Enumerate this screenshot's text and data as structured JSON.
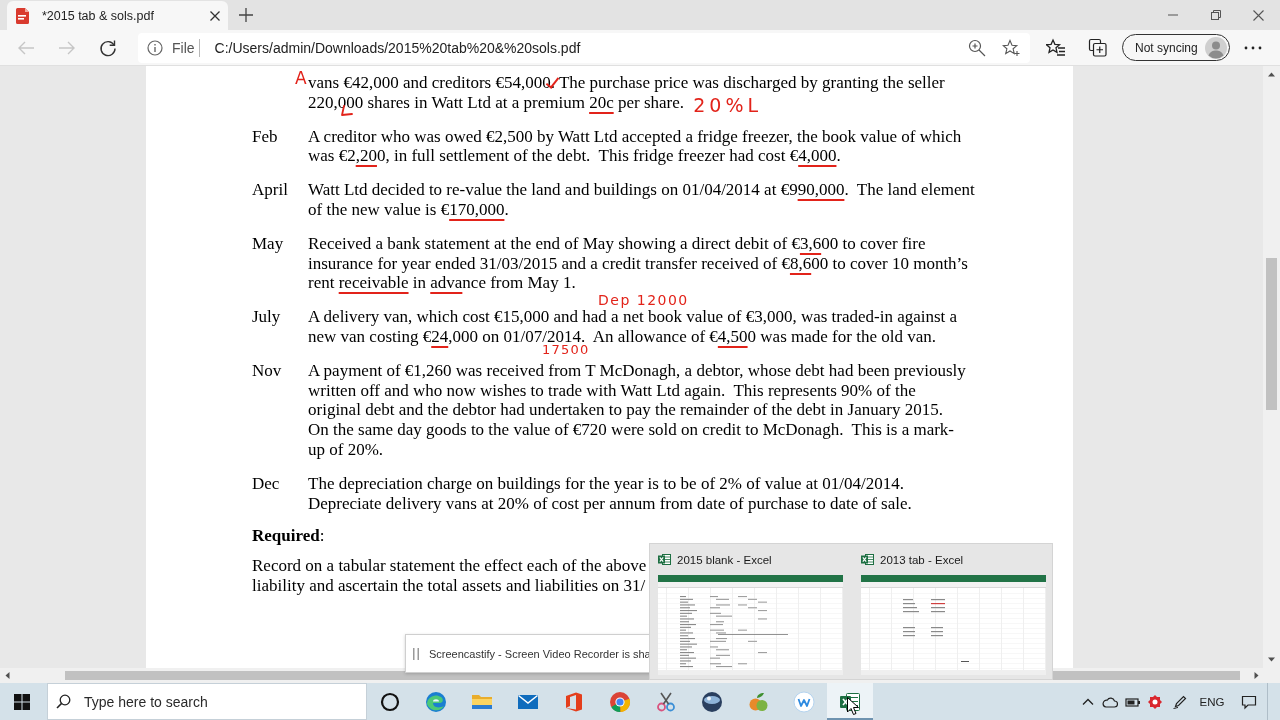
{
  "browser": {
    "tab": {
      "title": "*2015 tab & sols.pdf",
      "selected": true
    },
    "navigation": {
      "back": {
        "disabled": true
      },
      "forward": {
        "disabled": true
      }
    },
    "address_bar": {
      "scheme": "File",
      "url": "C:/Users/admin/Downloads/2015%20tab%20&%20sols.pdf"
    },
    "profile": {
      "label": "Not syncing"
    }
  },
  "document": {
    "entries": [
      {
        "runs": [
          {
            "kind": "printed",
            "text": "vans €42,000 and creditors €54,00"
          },
          {
            "kind": "ticked",
            "text": "0."
          },
          {
            "kind": "printed",
            "text": " The purchase price was discharged by granting the seller\n220,000 shares in Watt Ltd at a premium "
          },
          {
            "kind": "underlined",
            "text": "20c"
          },
          {
            "kind": "printed",
            "text": " per share. "
          },
          {
            "kind": "note",
            "text": "20%L"
          }
        ]
      },
      {
        "month": "Feb",
        "runs": [
          {
            "kind": "printed",
            "text": "A creditor who was owed €2,500 by Watt Ltd accepted a fridge freezer, the book value of which\nwas €2"
          },
          {
            "kind": "underlined",
            "text": ",20"
          },
          {
            "kind": "printed",
            "text": "0, in full settlement of the debt.  This fridge freezer had cost €"
          },
          {
            "kind": "underlined",
            "text": "4,000"
          },
          {
            "kind": "printed",
            "text": "."
          }
        ]
      },
      {
        "month": "April",
        "runs": [
          {
            "kind": "printed",
            "text": "Watt Ltd decided to re-value the land and buildings on 01/04/2014 at €9"
          },
          {
            "kind": "underlined",
            "text": "90,000"
          },
          {
            "kind": "printed",
            "text": ".  The land element\nof the new value is €"
          },
          {
            "kind": "underlined",
            "text": "170,000"
          },
          {
            "kind": "printed",
            "text": "."
          }
        ]
      },
      {
        "month": "May",
        "runs": [
          {
            "kind": "printed",
            "text": "Received a bank statement at the end of May showing a direct debit of €"
          },
          {
            "kind": "underlined",
            "text": "3,6"
          },
          {
            "kind": "printed",
            "text": "00 to cover fire\ninsurance for year ended 31/03/2015 and a credit transfer received of €"
          },
          {
            "kind": "underlined",
            "text": "8,6"
          },
          {
            "kind": "printed",
            "text": "00 to cover 10 month’s\nrent "
          },
          {
            "kind": "underlined",
            "text": "receivable"
          },
          {
            "kind": "printed",
            "text": " in "
          },
          {
            "kind": "underlined",
            "text": "adva"
          },
          {
            "kind": "printed",
            "text": "nce from May 1."
          }
        ]
      },
      {
        "month": "July",
        "runs": [
          {
            "kind": "printed",
            "text": "A delivery van, which cost €15,000 and had a net book value of €3,000, was traded-in against a\nnew van costing €"
          },
          {
            "kind": "underlined",
            "text": "24"
          },
          {
            "kind": "printed",
            "text": ",000 on 01/07/2014.  An allowance of €"
          },
          {
            "kind": "underlined",
            "text": "4,50"
          },
          {
            "kind": "printed",
            "text": "0 was made for the old van."
          }
        ]
      },
      {
        "month": "Nov",
        "runs": [
          {
            "kind": "printed",
            "text": "A payment of €1,260 was received from T McDonagh, a debtor, whose debt had been previously\nwritten off and who now wishes to trade with Watt Ltd again.  This represents 90% of the\noriginal debt and the debtor had undertaken to pay the remainder of the debt in January 2015.\nOn the same day goods to the value of €720 were sold on credit to McDonagh.  This is a mark-\nup of 20%."
          }
        ]
      },
      {
        "month": "Dec",
        "runs": [
          {
            "kind": "printed",
            "text": "The depreciation charge on buildings for the year is to be of 2% of value at 01/04/2014.\nDepreciate delivery vans at 20% of cost per annum from date of purchase to date of sale."
          }
        ]
      }
    ],
    "required": "**Required**:",
    "instruction": "Record on a tabular statement the effect each of the above\nliability and ascertain the total assets and liabilities on 31/",
    "annotations": [
      {
        "text": "A"
      },
      {
        "text": "Dep 12000"
      },
      {
        "text": "17500"
      }
    ]
  },
  "notification": {
    "text": "Screencastify - Screen Video Recorder is sha"
  },
  "taskbar_preview": {
    "windows": [
      {
        "title": "2015 blank - Excel"
      },
      {
        "title": "2013 tab - Excel"
      }
    ]
  },
  "taskbar": {
    "search": {
      "placeholder": "Type here to search"
    },
    "apps": [
      {
        "kind": "ring",
        "selected": false
      },
      {
        "kind": "swirl",
        "selected": false
      },
      {
        "kind": "folder",
        "selected": false
      },
      {
        "kind": "envelope",
        "selected": false
      },
      {
        "kind": "bracket",
        "selected": false
      },
      {
        "kind": "tricolor",
        "selected": false
      },
      {
        "kind": "scissors",
        "selected": false
      },
      {
        "kind": "sphere",
        "selected": false
      },
      {
        "kind": "fruit",
        "selected": false
      },
      {
        "kind": "letter-circle",
        "selected": false
      },
      {
        "kind": "spreadsheet",
        "selected": true
      }
    ],
    "tray": {
      "language": "ENG"
    }
  }
}
